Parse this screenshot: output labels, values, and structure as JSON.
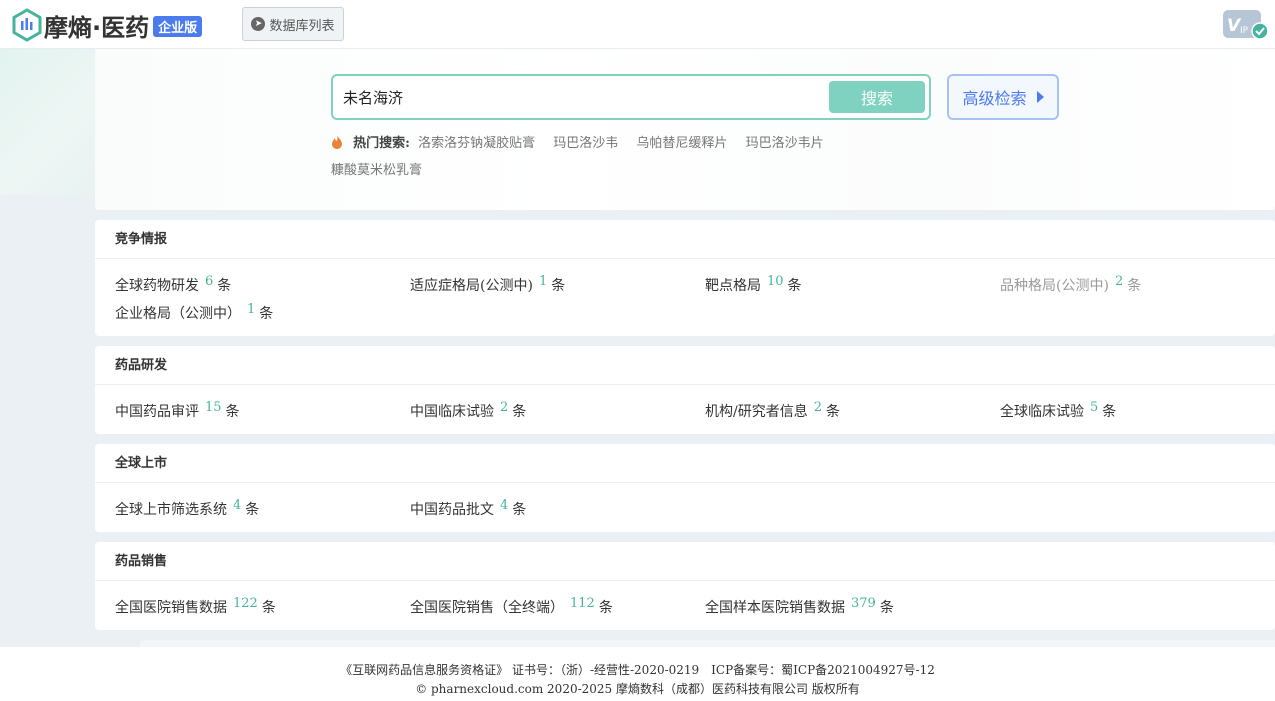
{
  "header": {
    "logo_text": "摩熵·医药",
    "logo_badge": "企业版",
    "db_list_label": "数据库列表",
    "vip_label": "VIP"
  },
  "search": {
    "value": "未名海济",
    "button_label": "搜索",
    "advanced_label": "高级检索",
    "hot_label": "热门搜索:",
    "hot_keywords": [
      "洛索洛芬钠凝胶贴膏",
      "玛巴洛沙韦",
      "乌帕替尼缓释片",
      "玛巴洛沙韦片",
      "糠酸莫米松乳膏"
    ]
  },
  "sections": [
    {
      "title": "竞争情报",
      "items": [
        {
          "label": "全球药物研发",
          "count": "6",
          "unit": "条"
        },
        {
          "label": "适应症格局(公测中)",
          "count": "1",
          "unit": "条"
        },
        {
          "label": "靶点格局",
          "count": "10",
          "unit": "条"
        },
        {
          "label": "品种格局(公测中)",
          "count": "2",
          "unit": "条",
          "disabled": true
        },
        {
          "label": "企业格局（公测中）",
          "count": "1",
          "unit": "条"
        }
      ]
    },
    {
      "title": "药品研发",
      "items": [
        {
          "label": "中国药品审评",
          "count": "15",
          "unit": "条"
        },
        {
          "label": "中国临床试验",
          "count": "2",
          "unit": "条"
        },
        {
          "label": "机构/研究者信息",
          "count": "2",
          "unit": "条"
        },
        {
          "label": "全球临床试验",
          "count": "5",
          "unit": "条"
        }
      ]
    },
    {
      "title": "全球上市",
      "items": [
        {
          "label": "全球上市筛选系统",
          "count": "4",
          "unit": "条"
        },
        {
          "label": "中国药品批文",
          "count": "4",
          "unit": "条"
        }
      ]
    },
    {
      "title": "药品销售",
      "items": [
        {
          "label": "全国医院销售数据",
          "count": "122",
          "unit": "条"
        },
        {
          "label": "全国医院销售（全终端）",
          "count": "112",
          "unit": "条"
        },
        {
          "label": "全国样本医院销售数据",
          "count": "379",
          "unit": "条"
        }
      ]
    }
  ],
  "footer": {
    "line1": "《互联网药品信息服务资格证》 证书号：（浙）-经营性-2020-0219　ICP备案号：蜀ICP备2021004927号-12",
    "line2": "© pharnexcloud.com 2020-2025 摩熵数科（成都）医药科技有限公司 版权所有"
  },
  "colors": {
    "accent": "#7fd1c0",
    "count": "#46b49d",
    "brand_blue": "#4b7bec"
  }
}
